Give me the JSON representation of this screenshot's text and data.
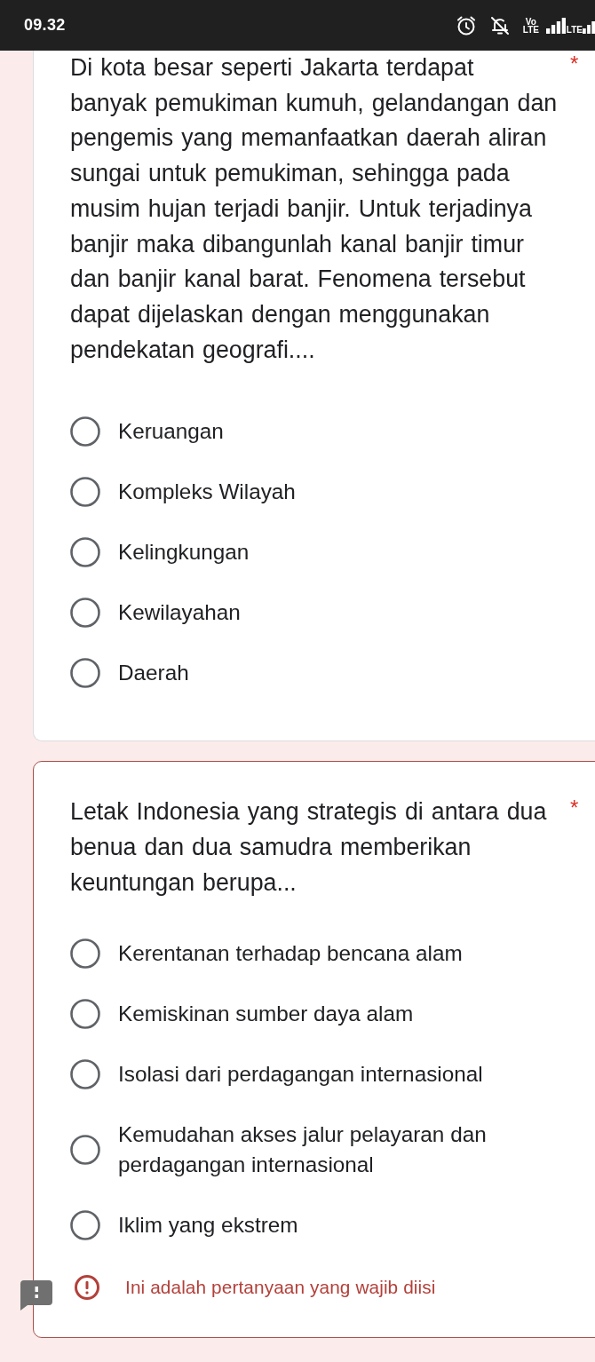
{
  "status_bar": {
    "time": "09.32",
    "volte": "Vo LTE",
    "network": "LTE"
  },
  "questions": [
    {
      "text": "Di kota besar seperti Jakarta terdapat banyak pemukiman kumuh, gelandangan dan pengemis yang memanfaatkan daerah aliran sungai untuk pemukiman, sehingga pada musim hujan terjadi banjir. Untuk terjadinya banjir maka dibangunlah kanal banjir timur dan banjir kanal barat. Fenomena tersebut dapat dijelaskan dengan menggunakan pendekatan geografi....",
      "required_mark": "*",
      "error": false,
      "options": [
        {
          "label": "Keruangan",
          "selected": false
        },
        {
          "label": "Kompleks Wilayah",
          "selected": false
        },
        {
          "label": "Kelingkungan",
          "selected": false
        },
        {
          "label": "Kewilayahan",
          "selected": false
        },
        {
          "label": "Daerah",
          "selected": false
        }
      ]
    },
    {
      "text": "Letak Indonesia yang strategis di antara dua benua dan dua samudra memberikan keuntungan berupa...",
      "required_mark": "*",
      "error": true,
      "error_message": "Ini adalah pertanyaan yang wajib diisi",
      "options": [
        {
          "label": "Kerentanan terhadap bencana alam",
          "selected": false
        },
        {
          "label": "Kemiskinan sumber daya alam",
          "selected": false
        },
        {
          "label": "Isolasi dari perdagangan internasional",
          "selected": false
        },
        {
          "label": "Kemudahan akses jalur pelayaran dan perdagangan internasional",
          "selected": false
        },
        {
          "label": "Iklim yang ekstrem",
          "selected": false
        }
      ]
    }
  ]
}
